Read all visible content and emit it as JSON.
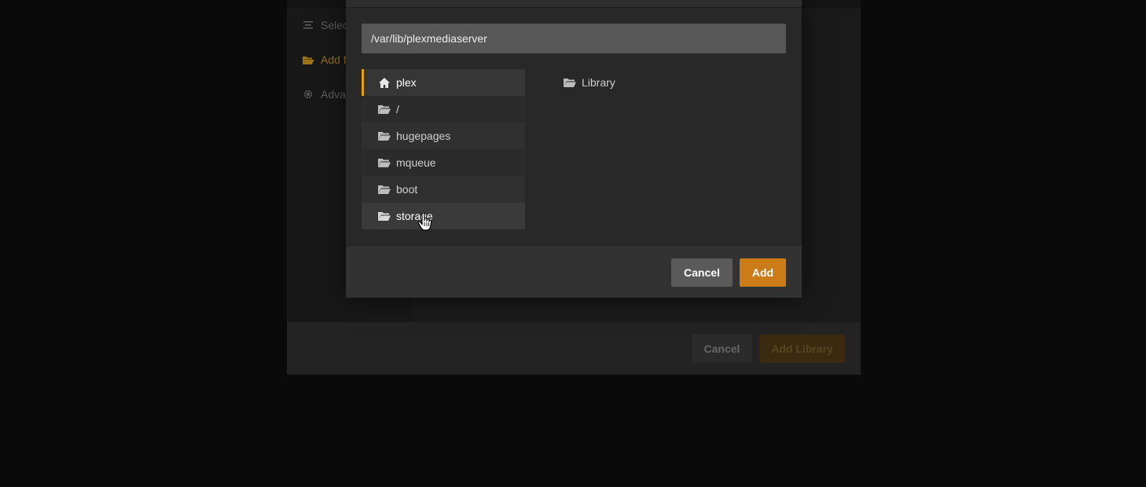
{
  "background_dialog": {
    "nav": [
      {
        "label": "Selec",
        "icon": "list-icon"
      },
      {
        "label": "Add f",
        "icon": "folder-open-icon",
        "active": true
      },
      {
        "label": "Adva",
        "icon": "gear-icon"
      }
    ],
    "cancel_label": "Cancel",
    "add_library_label": "Add Library"
  },
  "browser": {
    "path_value": "/var/lib/plexmediaserver",
    "folders": [
      {
        "label": "plex",
        "icon": "home-icon",
        "selected": true
      },
      {
        "label": "/",
        "icon": "folder-icon"
      },
      {
        "label": "hugepages",
        "icon": "folder-icon"
      },
      {
        "label": "mqueue",
        "icon": "folder-icon"
      },
      {
        "label": "boot",
        "icon": "folder-icon"
      },
      {
        "label": "storage",
        "icon": "folder-icon",
        "hovered": true
      }
    ],
    "subfolders": [
      {
        "label": "Library",
        "icon": "folder-icon"
      }
    ],
    "cancel_label": "Cancel",
    "add_label": "Add"
  },
  "colors": {
    "accent": "#e5a00d",
    "add_button": "#cc7b19",
    "cancel_button": "#5a5a5a"
  }
}
